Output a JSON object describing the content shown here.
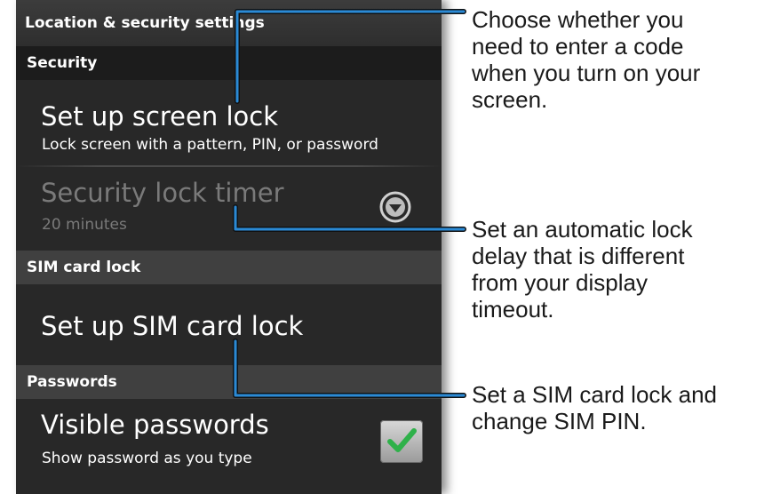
{
  "screen": {
    "title": "Location & security settings",
    "sections": {
      "security": "Security",
      "sim_card_lock": "SIM card lock",
      "passwords": "Passwords"
    },
    "items": {
      "screen_lock": {
        "title": "Set up screen lock",
        "summary": "Lock screen with a pattern, PIN, or password"
      },
      "lock_timer": {
        "title": "Security lock timer",
        "summary": "20 minutes",
        "enabled": false
      },
      "sim_lock": {
        "title": "Set up SIM card lock"
      },
      "visible_passwords": {
        "title": "Visible passwords",
        "summary": "Show password as you type",
        "checked": true
      }
    }
  },
  "callouts": [
    {
      "lines": [
        "Choose whether you",
        "need to enter a code",
        "when you turn on your",
        "screen."
      ]
    },
    {
      "lines": [
        "Set an automatic lock",
        "delay that is different",
        "from your display",
        "timeout."
      ]
    },
    {
      "lines": [
        "Set a SIM card lock and",
        "change SIM PIN."
      ]
    }
  ],
  "colors": {
    "screen_background": "#282828",
    "section_header": "#404040",
    "disabled_text": "#7a7a7a",
    "check_green": "#2fb14a",
    "leader_line": "#2a8ad6"
  },
  "icons": {
    "lock_timer_dropdown": "chevron-down-circle-icon",
    "visible_passwords_checkbox": "checkmark-icon"
  }
}
